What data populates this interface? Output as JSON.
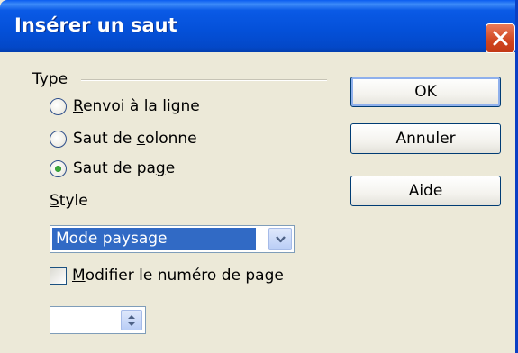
{
  "window": {
    "title": "Insérer un saut"
  },
  "type_group": {
    "label": "Type",
    "options": [
      {
        "pre": "",
        "accel": "R",
        "post": "envoi à la ligne",
        "checked": false
      },
      {
        "pre": "Saut de ",
        "accel": "c",
        "post": "olonne",
        "checked": false
      },
      {
        "pre": "Saut de pa",
        "accel": "g",
        "post": "e",
        "checked": true
      }
    ]
  },
  "style": {
    "label_accel": "S",
    "label_rest": "tyle",
    "selected": "Mode paysage"
  },
  "page_number": {
    "checkbox_accel": "M",
    "checkbox_rest": "odifier le numéro de page",
    "checked": false,
    "value": ""
  },
  "buttons": {
    "ok": "OK",
    "cancel": "Annuler",
    "help": "Aide"
  },
  "colors": {
    "titlebar": "#0450d8",
    "close": "#d0451f",
    "selection": "#316ac5",
    "dialog_bg": "#ece9d8"
  }
}
